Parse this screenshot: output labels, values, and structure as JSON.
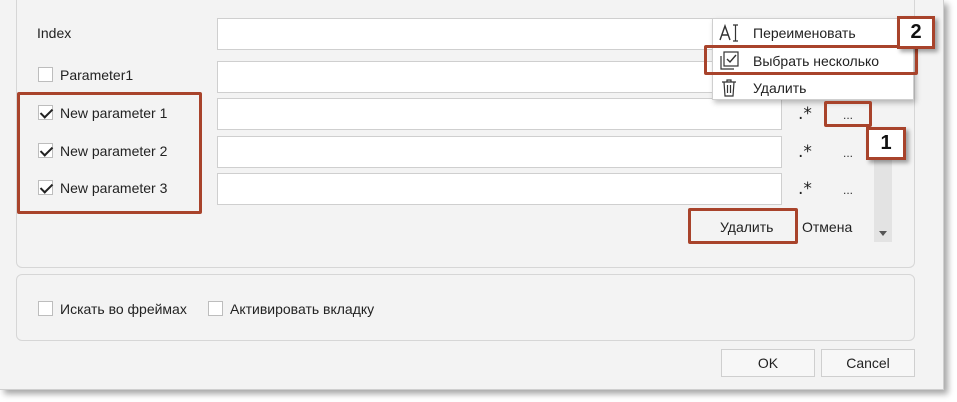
{
  "params": {
    "index_label": "Index",
    "param1_label": "Parameter1",
    "new1_label": "New parameter 1",
    "new2_label": "New parameter 2",
    "new3_label": "New parameter 3",
    "regex_glyph": ".*",
    "more_glyph": "..."
  },
  "actions": {
    "delete_label": "Удалить",
    "cancel_label": "Отмена"
  },
  "options": {
    "search_frames_label": "Искать во фреймах",
    "activate_tab_label": "Активировать вкладку"
  },
  "footer": {
    "ok_label": "OK",
    "cancel_label": "Cancel"
  },
  "context_menu": {
    "rename_label": "Переименовать",
    "select_multiple_label": "Выбрать несколько",
    "delete_label": "Удалить"
  },
  "callouts": {
    "step1": "1",
    "step2": "2"
  },
  "colors": {
    "callout_red": "#a8432b",
    "panel_bg": "#f3f3f3"
  }
}
